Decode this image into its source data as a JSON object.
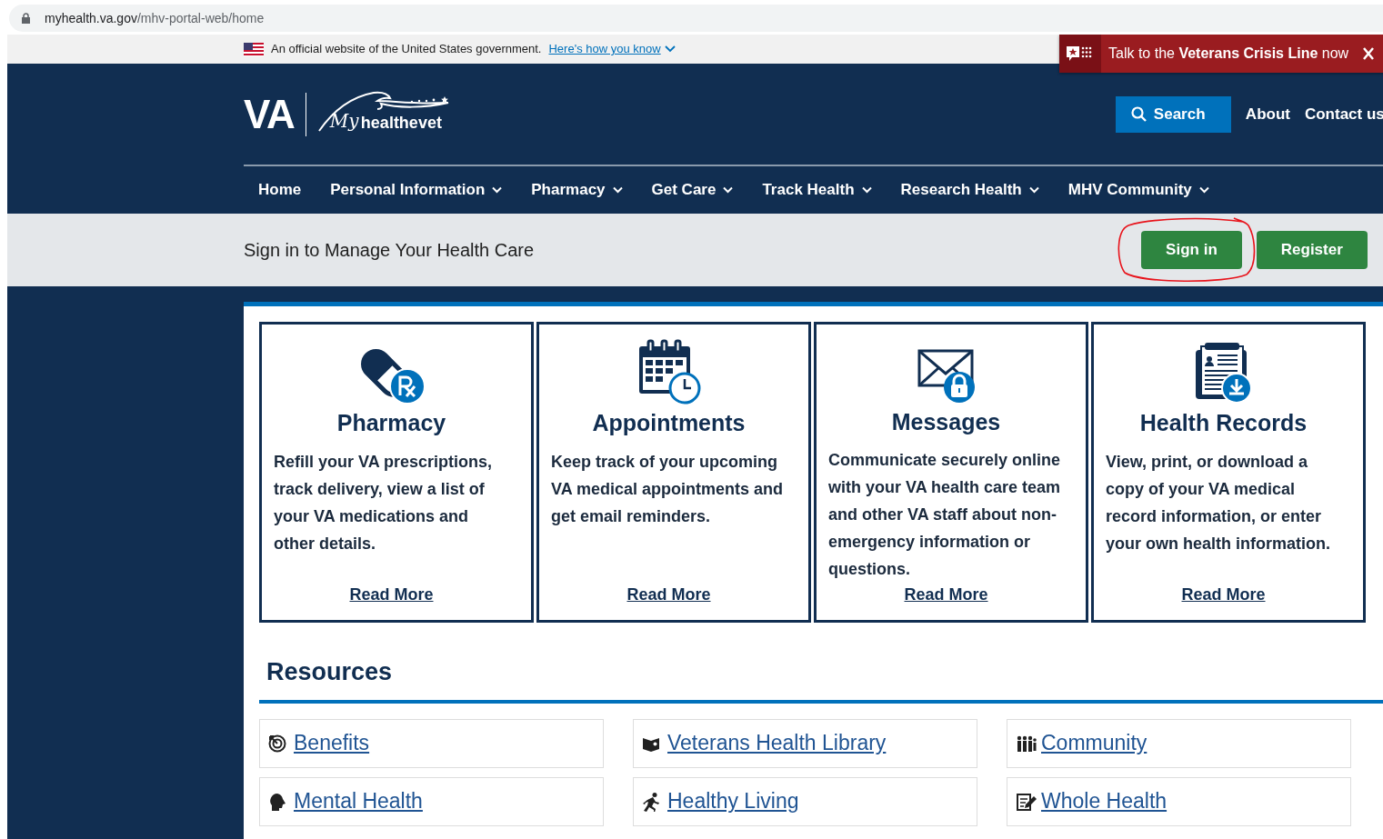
{
  "browser": {
    "url_host": "myhealth.va.gov",
    "url_path": "/mhv-portal-web/home"
  },
  "gov_banner": {
    "text": "An official website of the United States government.",
    "link": "Here's how you know"
  },
  "crisis_line": {
    "text": "Talk to the **Veterans Crisis Line** now"
  },
  "header": {
    "logo_text": "VA",
    "logo_script": "My",
    "logo_word": "healthevet",
    "search_button": "Search",
    "links": [
      "About",
      "Contact us"
    ]
  },
  "nav": [
    {
      "label": "Home",
      "has_menu": false
    },
    {
      "label": "Personal Information",
      "has_menu": true
    },
    {
      "label": "Pharmacy",
      "has_menu": true
    },
    {
      "label": "Get Care",
      "has_menu": true
    },
    {
      "label": "Track Health",
      "has_menu": true
    },
    {
      "label": "Research Health",
      "has_menu": true
    },
    {
      "label": "MHV Community",
      "has_menu": true
    }
  ],
  "sign_in_bar": {
    "text": "Sign in to Manage Your Health Care",
    "buttons": [
      {
        "label": "Sign in",
        "circled": true
      },
      {
        "label": "Register",
        "circled": false
      }
    ]
  },
  "features": [
    {
      "title": "Pharmacy",
      "description": "Refill your VA prescriptions, track delivery, view a list of your VA medications and other details.",
      "link": "Read More"
    },
    {
      "title": "Appointments",
      "description": "Keep track of your upcoming VA medical appointments and get email reminders.",
      "link": "Read More"
    },
    {
      "title": "Messages",
      "description": "Communicate securely online with your VA health care team and other VA staff about non-emergency information or questions.",
      "link": "Read More"
    },
    {
      "title": "Health Records",
      "description": "View, print, or download a copy of your VA medical record information, or enter your own health information.",
      "link": "Read More"
    }
  ],
  "resources": {
    "title": "Resources",
    "items": [
      {
        "label": "Benefits"
      },
      {
        "label": "Veterans Health Library"
      },
      {
        "label": "Community"
      },
      {
        "label": "Mental Health"
      },
      {
        "label": "Healthy Living"
      },
      {
        "label": "Whole Health"
      }
    ]
  }
}
